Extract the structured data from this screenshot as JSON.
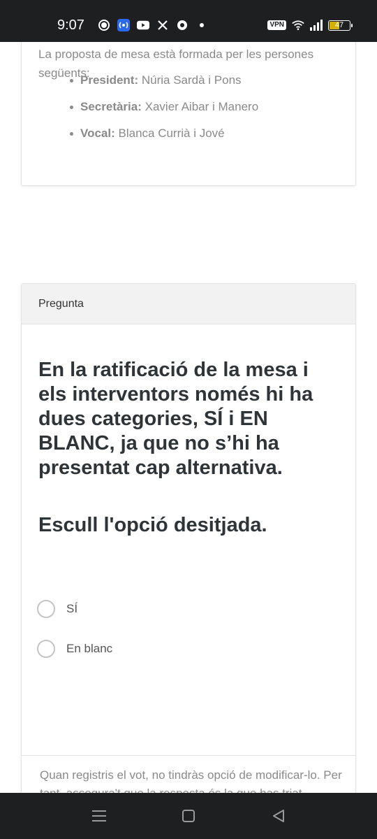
{
  "status_bar": {
    "time": "9:07",
    "vpn_label": "VPN",
    "battery_level": "47",
    "icons": [
      "signal-app-icon",
      "radio-app-icon",
      "youtube-icon",
      "x-icon",
      "chrome-icon",
      "dot-icon",
      "vpn-icon",
      "wifi-icon",
      "cell-signal-icon",
      "battery-icon"
    ]
  },
  "intro_card": {
    "text": "La proposta de mesa està formada per les persones següents:",
    "members": [
      {
        "role": "President:",
        "name": "Núria Sardà i Pons"
      },
      {
        "role": "Secretària:",
        "name": "Xavier Aibar i Manero"
      },
      {
        "role": "Vocal:",
        "name": "Blanca Currià i Jové"
      }
    ]
  },
  "question_card": {
    "header": "Pregunta",
    "question": "En la ratificació de la mesa i els interventors només hi ha dues categories, SÍ i EN BLANC, ja que no s’hi ha presentat cap alternativa.",
    "instruction": "Escull l'opció desitjada.",
    "options": [
      {
        "label": "SÍ",
        "selected": false
      },
      {
        "label": "En blanc",
        "selected": false
      }
    ],
    "notice": "Quan registris el vot, no tindràs opció de modificar-lo. Per tant, assegura't que la resposta és la que has triat."
  },
  "nav_bar": {
    "icons": [
      "menu-icon",
      "home-icon",
      "back-icon"
    ]
  },
  "colors": {
    "system_bar": "#1d1f21",
    "heading_text": "#2f3438",
    "muted_text": "#8a8a8a",
    "header_bg": "#f2f2f2",
    "battery_fill": "#d4b000"
  }
}
